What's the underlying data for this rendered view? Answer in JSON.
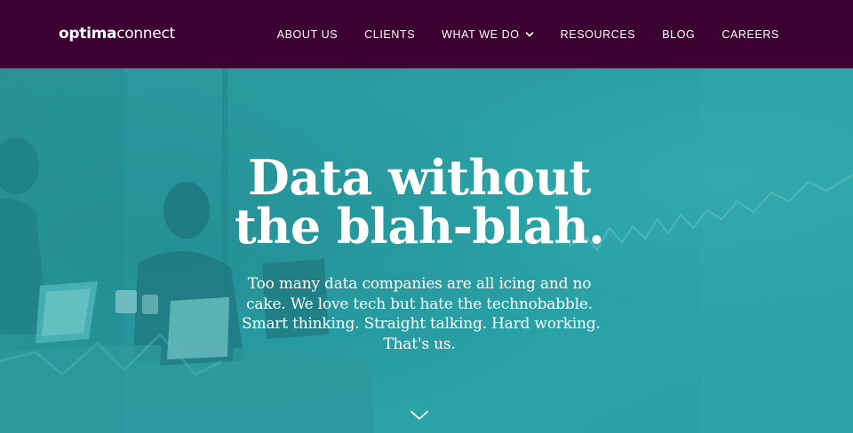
{
  "brand": {
    "logo_bold": "optima",
    "logo_light": "connect"
  },
  "nav": {
    "items": [
      {
        "label": "ABOUT US"
      },
      {
        "label": "CLIENTS"
      },
      {
        "label": "WHAT WE DO",
        "has_dropdown": true
      },
      {
        "label": "RESOURCES"
      },
      {
        "label": "BLOG"
      },
      {
        "label": "CAREERS"
      }
    ]
  },
  "hero": {
    "headline_lines": [
      "Data without",
      "the blah-blah."
    ],
    "subtext_lines": [
      "Too many data companies are all icing and no",
      "cake. We love tech but hate the technobabble.",
      "Smart thinking. Straight talking. Hard working.",
      "That's us."
    ],
    "scroll_icon": "chevron-down-icon"
  },
  "colors": {
    "header_bg": "#3c0131",
    "hero_teal": "#2aa0a4",
    "text": "#ffffff"
  }
}
